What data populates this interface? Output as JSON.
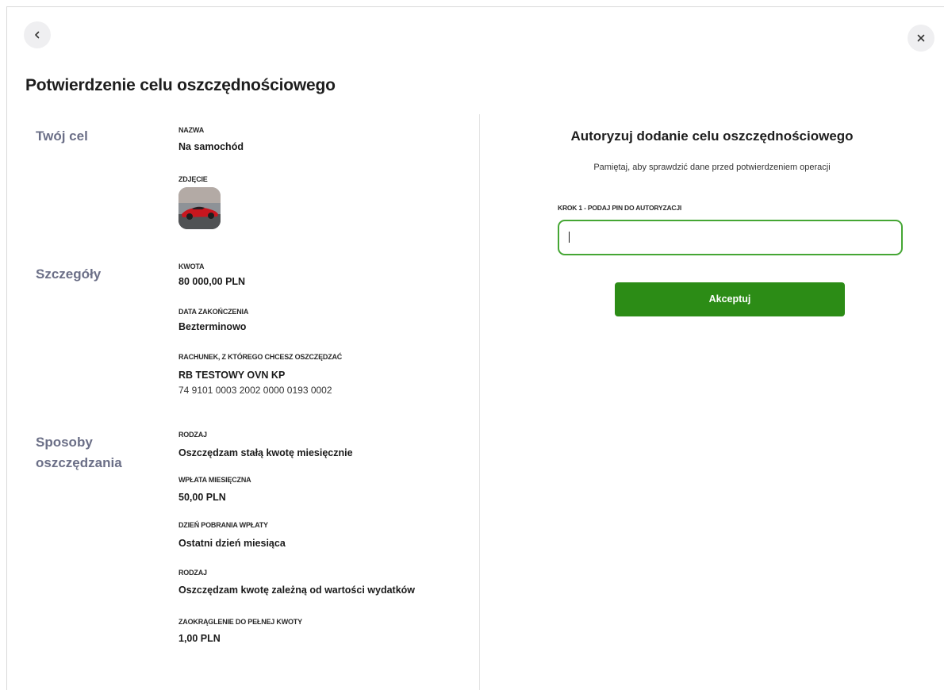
{
  "header": {
    "title": "Potwierdzenie celu oszczędnościowego",
    "back_icon": "chevron-left-icon",
    "close_icon": "close-icon"
  },
  "goal": {
    "heading": "Twój cel",
    "name_label": "NAZWA",
    "name_value": "Na samochód",
    "photo_label": "ZDJĘCIE"
  },
  "details": {
    "heading": "Szczegóły",
    "amount_label": "KWOTA",
    "amount_value": "80 000,00 PLN",
    "end_date_label": "DATA ZAKOŃCZENIA",
    "end_date_value": "Bezterminowo",
    "account_label": "RACHUNEK, Z KTÓREGO CHCESZ OSZCZĘDZAĆ",
    "account_name": "RB TESTOWY OVN KP",
    "account_number": "74 9101 0003 2002 0000 0193 0002"
  },
  "methods": {
    "heading_line1": "Sposoby",
    "heading_line2": "oszczędzania",
    "type1_label": "RODZAJ",
    "type1_value": "Oszczędzam stałą kwotę miesięcznie",
    "monthly_label": "WPŁATA MIESIĘCZNA",
    "monthly_value": "50,00 PLN",
    "day_label": "DZIEŃ POBRANIA WPŁATY",
    "day_value": "Ostatni dzień miesiąca",
    "type2_label": "RODZAJ",
    "type2_value": "Oszczędzam kwotę zależną od wartości wydatków",
    "rounding_label": "ZAOKRĄGLENIE DO PEŁNEJ KWOTY",
    "rounding_value": "1,00 PLN"
  },
  "auth": {
    "title": "Autoryzuj dodanie celu oszczędnościowego",
    "subtitle": "Pamiętaj, aby sprawdzić dane przed potwierdzeniem operacji",
    "pin_label": "KROK 1 - PODAJ PIN DO AUTORYZACJI",
    "pin_value": "",
    "accept_label": "Akceptuj"
  },
  "colors": {
    "accent_green": "#2c8c16",
    "input_border": "#45a634",
    "section_heading": "#6b6f87"
  }
}
